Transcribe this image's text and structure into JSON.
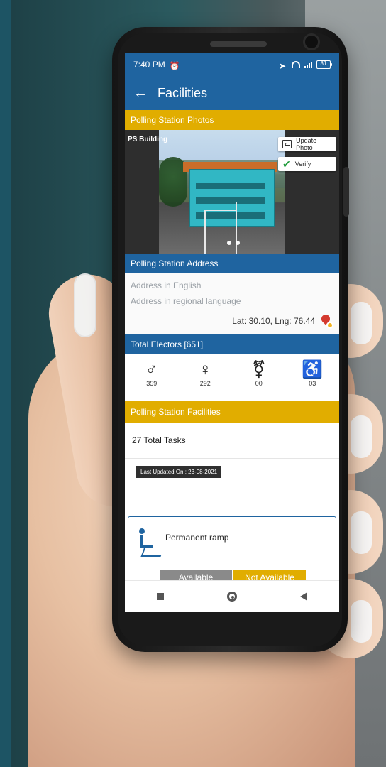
{
  "status_bar": {
    "time": "7:40 PM",
    "battery": "81"
  },
  "app_bar": {
    "back_icon": "arrow-left-icon",
    "title": "Facilities"
  },
  "sections": {
    "photos": {
      "title": "Polling Station Photos",
      "photo_label": "PS Building",
      "update_photo_label": "Update Photo",
      "verify_label": "Verify"
    },
    "address": {
      "title": "Polling Station Address",
      "english_placeholder": "Address in English",
      "regional_placeholder": "Address in regional language",
      "latlng": "Lat: 30.10, Lng: 76.44"
    },
    "electors": {
      "title": "Total Electors [651]",
      "items": [
        {
          "name": "male-elector-icon",
          "value": "359"
        },
        {
          "name": "female-elector-icon",
          "value": "292"
        },
        {
          "name": "third-gender-elector-icon",
          "value": "00"
        },
        {
          "name": "pwd-elector-icon",
          "value": "03"
        }
      ]
    },
    "facilities": {
      "title": "Polling Station Facilities",
      "total_tasks": "27 Total Tasks",
      "last_updated": "Last Updated On : 23-08-2021",
      "card": {
        "title": "Permanent ramp",
        "available_label": "Available",
        "not_available_label": "Not Available"
      }
    }
  },
  "colors": {
    "primary": "#1f64a0",
    "accent": "#e1ad00"
  }
}
